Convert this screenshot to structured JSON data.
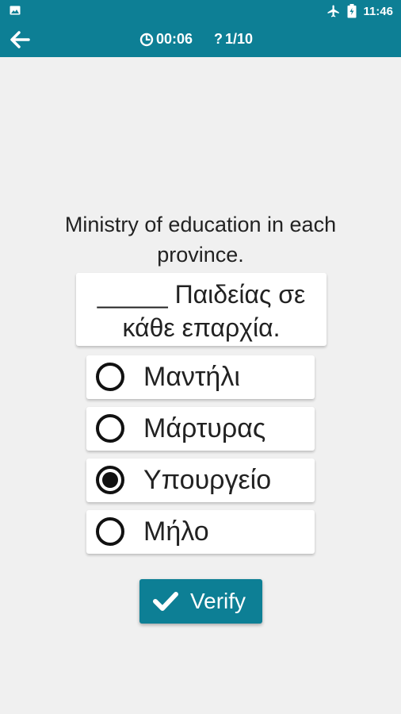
{
  "status_bar": {
    "time": "11:46",
    "icons": [
      "image-icon",
      "airplane-icon",
      "battery-icon"
    ]
  },
  "header": {
    "timer": "00:06",
    "progress": "1/10",
    "icons": [
      "back-arrow-icon",
      "clock-icon",
      "question-icon"
    ]
  },
  "question": {
    "prompt": "Ministry of education in each province.",
    "sentence": "_____ Παιδείας σε κάθε επαρχία."
  },
  "options": [
    {
      "label": "Μαντήλι",
      "selected": false
    },
    {
      "label": "Μάρτυρας",
      "selected": false
    },
    {
      "label": "Υπουργείο",
      "selected": true
    },
    {
      "label": "Μήλο",
      "selected": false
    }
  ],
  "verify_button": {
    "label": "Verify",
    "icon": "check-icon"
  },
  "colors": {
    "primary": "#0d7f95",
    "background": "#f0f0f0",
    "card": "#ffffff"
  }
}
